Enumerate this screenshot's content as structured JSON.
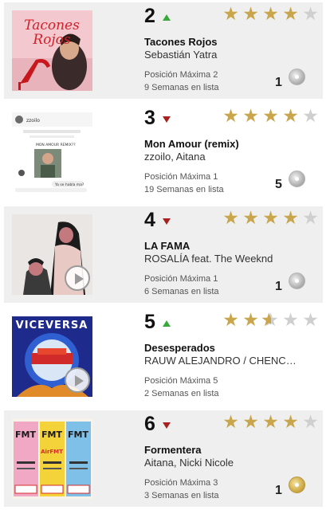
{
  "entries": [
    {
      "rank": "2",
      "trend": "up",
      "rating": 4,
      "title": "Tacones Rojos",
      "artist": "Sebastián Yatra",
      "peak": "Posición Máxima 2",
      "weeks": "9 Semanas en lista",
      "cert_count": "1",
      "cert_type": "platinum",
      "cover_text": [
        "Tacones",
        "Rojos"
      ],
      "has_play": false
    },
    {
      "rank": "3",
      "trend": "down",
      "rating": 4,
      "title": "Mon Amour (remix)",
      "artist": "zzoilo, Aitana",
      "peak": "Posición Máxima 1",
      "weeks": "19 Semanas en lista",
      "cert_count": "5",
      "cert_type": "platinum",
      "cover_text": [
        "zzoilo",
        "MON AMOUR REMIX??",
        "Ya se habla ma?"
      ],
      "has_play": false
    },
    {
      "rank": "4",
      "trend": "down",
      "rating": 4,
      "title": "LA FAMA",
      "artist": "ROSALÍA feat. The Weeknd",
      "peak": "Posición Máxima 1",
      "weeks": "6 Semanas en lista",
      "cert_count": "1",
      "cert_type": "platinum",
      "cover_text": [],
      "has_play": true
    },
    {
      "rank": "5",
      "trend": "up",
      "rating": 2.5,
      "title": "Desesperados",
      "artist": "RAUW ALEJANDRO / CHENCHO CORLEONE",
      "peak": "Posición Máxima 5",
      "weeks": "2 Semanas en lista",
      "cert_count": "",
      "cert_type": "",
      "cover_text": [
        "VICEVERSA"
      ],
      "has_play": true
    },
    {
      "rank": "6",
      "trend": "down",
      "rating": 4,
      "title": "Formentera",
      "artist": "Aitana, Nicki Nicole",
      "peak": "Posición Máxima 3",
      "weeks": "3 Semanas en lista",
      "cert_count": "1",
      "cert_type": "gold",
      "cover_text": [
        "FMT",
        "FMT",
        "FMT",
        "AirFMT"
      ],
      "has_play": false
    }
  ],
  "colors": {
    "star_full": "#c9a54c",
    "star_empty": "#cfcfcf",
    "trend_up": "#3aa83a",
    "trend_down": "#a82121",
    "row_shade": "#efefef"
  }
}
